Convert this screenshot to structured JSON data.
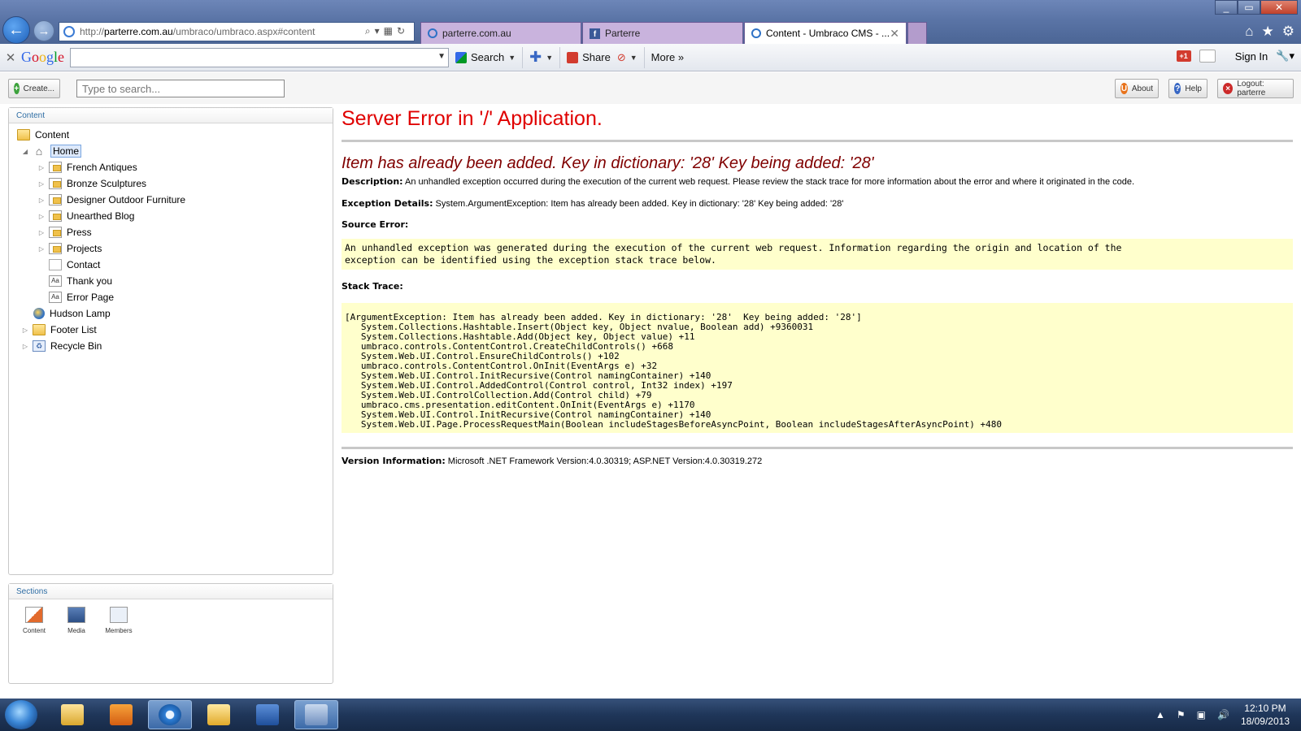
{
  "browser": {
    "address": {
      "prefix": "http://",
      "domain": "parterre.com.au",
      "path": "/umbraco/umbraco.aspx#content"
    },
    "tabs": [
      {
        "label": "parterre.com.au"
      },
      {
        "label": "Parterre"
      },
      {
        "label": "Content - Umbraco CMS - ..."
      }
    ]
  },
  "google_toolbar": {
    "search_label": "Search",
    "share_label": "Share",
    "more_label": "More »",
    "signin_label": "Sign In",
    "gplus_label": "+1"
  },
  "umbraco": {
    "create_label": "Create...",
    "search_placeholder": "Type to search...",
    "about_label": "About",
    "help_label": "Help",
    "logout_label": "Logout: parterre"
  },
  "content_panel": {
    "title": "Content",
    "tree": [
      "Content",
      "Home",
      "French Antiques",
      "Bronze Sculptures",
      "Designer Outdoor Furniture",
      "Unearthed Blog",
      "Press",
      "Projects",
      "Contact",
      "Thank you",
      "Error Page",
      "Hudson Lamp",
      "Footer List",
      "Recycle Bin"
    ]
  },
  "sections_panel": {
    "title": "Sections",
    "items": [
      "Content",
      "Media",
      "Members"
    ]
  },
  "error": {
    "title": "Server Error in '/' Application.",
    "heading": "Item has already been added. Key in dictionary: '28'  Key being added: '28'",
    "description_label": "Description:",
    "description": "An unhandled exception occurred during the execution of the current web request. Please review the stack trace for more information about the error and where it originated in the code.",
    "exception_label": "Exception Details:",
    "exception": "System.ArgumentException: Item has already been added. Key in dictionary: '28'  Key being added: '28'",
    "source_label": "Source Error:",
    "source_text": "An unhandled exception was generated during the execution of the current web request. Information regarding the origin and location of the\nexception can be identified using the exception stack trace below.",
    "stack_label": "Stack Trace:",
    "stack_text": "[ArgumentException: Item has already been added. Key in dictionary: '28'  Key being added: '28']\n   System.Collections.Hashtable.Insert(Object key, Object nvalue, Boolean add) +9360031\n   System.Collections.Hashtable.Add(Object key, Object value) +11\n   umbraco.controls.ContentControl.CreateChildControls() +668\n   System.Web.UI.Control.EnsureChildControls() +102\n   umbraco.controls.ContentControl.OnInit(EventArgs e) +32\n   System.Web.UI.Control.InitRecursive(Control namingContainer) +140\n   System.Web.UI.Control.AddedControl(Control control, Int32 index) +197\n   System.Web.UI.ControlCollection.Add(Control child) +79\n   umbraco.cms.presentation.editContent.OnInit(EventArgs e) +1170\n   System.Web.UI.Control.InitRecursive(Control namingContainer) +140\n   System.Web.UI.Page.ProcessRequestMain(Boolean includeStagesBeforeAsyncPoint, Boolean includeStagesAfterAsyncPoint) +480",
    "version_label": "Version Information:",
    "version": "Microsoft .NET Framework Version:4.0.30319; ASP.NET Version:4.0.30319.272"
  },
  "taskbar": {
    "time": "12:10 PM",
    "date": "18/09/2013"
  },
  "colors": {
    "error_red": "#e00000",
    "heading_maroon": "#800000",
    "code_bg": "#ffffcc",
    "link_blue": "#2e6da4"
  }
}
